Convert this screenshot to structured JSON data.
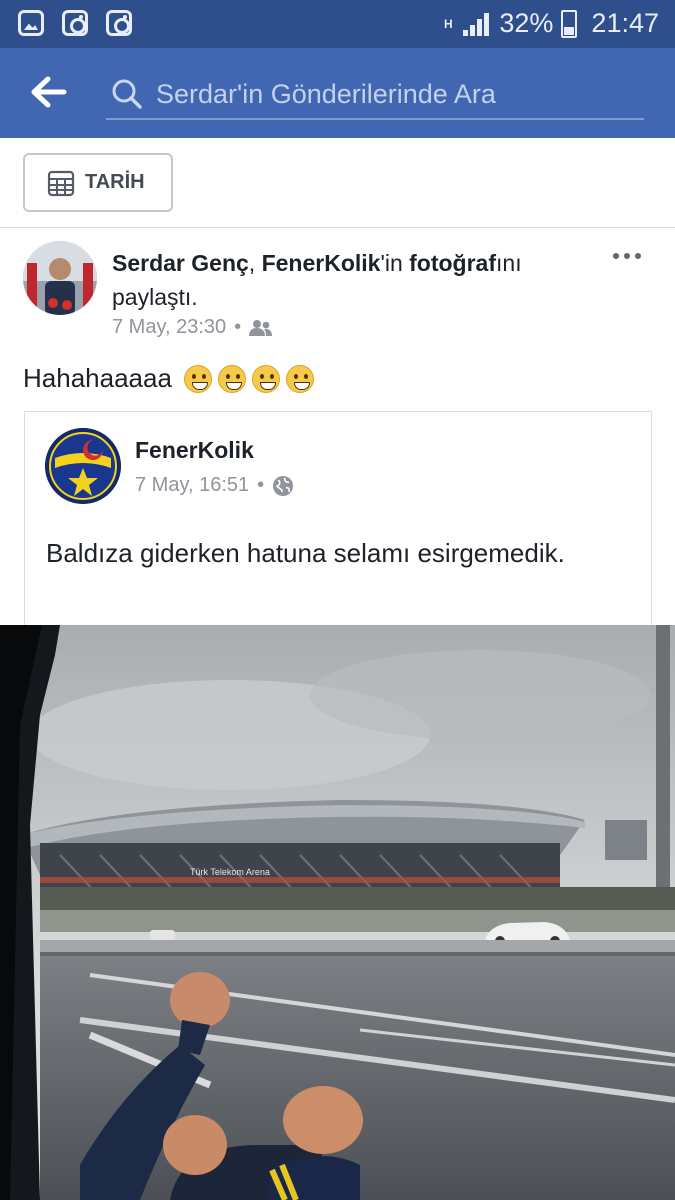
{
  "status_bar": {
    "battery": "32%",
    "time": "21:47",
    "network": "H"
  },
  "search": {
    "placeholder": "Serdar'in Gönderilerinde Ara"
  },
  "filter": {
    "date_label": "TARİH"
  },
  "post": {
    "author": "Serdar Genç",
    "separator": ", ",
    "page_ref": "FenerKolik",
    "page_suffix": "'in ",
    "object": "fotoğraf",
    "object_suffix": "ını paylaştı.",
    "timestamp": "7 May, 23:30",
    "dot": "•",
    "text": "Hahahaaaaa",
    "shared": {
      "page_name": "FenerKolik",
      "timestamp": "7 May, 16:51",
      "dot": "•",
      "text": "Baldıza giderken hatuna selamı esirgemedik.",
      "logo_text": "FENER KOLİK"
    },
    "photo_sign": "Türk Telekom Arena"
  },
  "colors": {
    "status_bar": "#2f4f8c",
    "header": "#4267b2"
  }
}
